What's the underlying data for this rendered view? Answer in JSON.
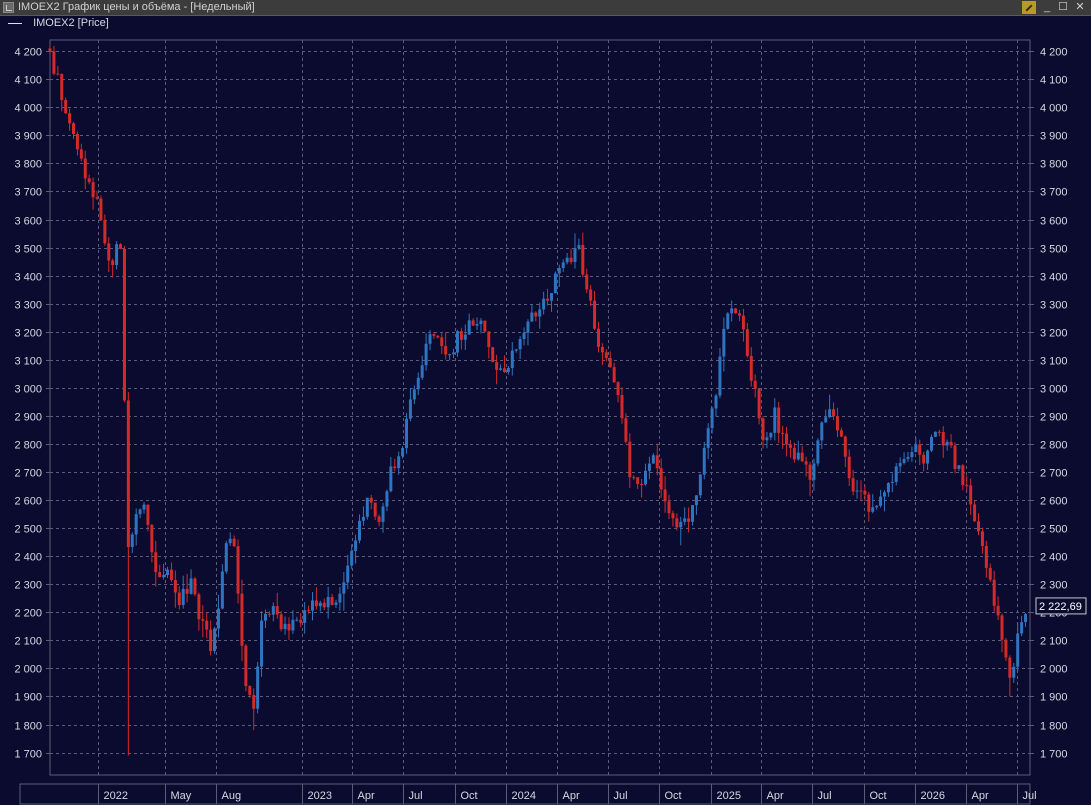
{
  "window": {
    "title": "IMOEX2 График цены и объёма - [Недельный]",
    "minimize_label": "_",
    "maximize_label": "☐",
    "close_label": "✕"
  },
  "legend": {
    "label": "IMOEX2 [Price]"
  },
  "colors": {
    "background": "#0a0b2e",
    "grid": "#5a5c78",
    "up": "#2f74c0",
    "down": "#d42a2a",
    "axis_text": "#d8d8e0"
  },
  "chart_data": {
    "type": "candlestick",
    "series_name": "IMOEX2 [Price]",
    "timeframe": "weekly",
    "ylim": [
      1620,
      4240
    ],
    "y_ticks": [
      "4 200",
      "4 100",
      "4 000",
      "3 900",
      "3 800",
      "3 700",
      "3 600",
      "3 500",
      "3 400",
      "3 300",
      "3 200",
      "3 100",
      "3 000",
      "2 900",
      "2 800",
      "2 700",
      "2 600",
      "2 500",
      "2 400",
      "2 300",
      "2 200",
      "2 100",
      "2 000",
      "1 900",
      "1 800",
      "1 700"
    ],
    "y_tick_values": [
      4200,
      4100,
      4000,
      3900,
      3800,
      3700,
      3600,
      3500,
      3400,
      3300,
      3200,
      3100,
      3000,
      2900,
      2800,
      2700,
      2600,
      2500,
      2400,
      2300,
      2200,
      2100,
      2000,
      1900,
      1800,
      1700
    ],
    "x_ticks": [
      {
        "label": "2022",
        "date": "2022-01-01"
      },
      {
        "label": "May",
        "date": "2022-05-01"
      },
      {
        "label": "Aug",
        "date": "2022-08-01"
      },
      {
        "label": "2023",
        "date": "2023-01-01"
      },
      {
        "label": "Apr",
        "date": "2023-04-01"
      },
      {
        "label": "Jul",
        "date": "2023-07-01"
      },
      {
        "label": "Oct",
        "date": "2023-10-01"
      },
      {
        "label": "2024",
        "date": "2024-01-01"
      },
      {
        "label": "Apr",
        "date": "2024-04-01"
      },
      {
        "label": "Jul",
        "date": "2024-07-01"
      },
      {
        "label": "Oct",
        "date": "2024-10-01"
      },
      {
        "label": "2025",
        "date": "2025-01-01"
      },
      {
        "label": "Apr",
        "date": "2025-04-01"
      },
      {
        "label": "Jul",
        "date": "2025-07-01"
      },
      {
        "label": "Oct",
        "date": "2025-10-01"
      },
      {
        "label": "2026",
        "date": "2026-01-01"
      },
      {
        "label": "Apr",
        "date": "2026-04-01"
      },
      {
        "label": "Jul",
        "date": "2026-07-01"
      }
    ],
    "x_range": [
      "2021-10-08",
      "2026-07-25"
    ],
    "last_price_label": "2 222,69",
    "last_price": 2222.69,
    "close_path": [
      [
        "2021-10-08",
        4200
      ],
      [
        "2021-10-29",
        4050
      ],
      [
        "2021-11-19",
        3900
      ],
      [
        "2021-12-03",
        3800
      ],
      [
        "2021-12-17",
        3750
      ],
      [
        "2022-01-07",
        3620
      ],
      [
        "2022-01-21",
        3450
      ],
      [
        "2022-02-11",
        3500
      ],
      [
        "2022-02-25",
        2450
      ],
      [
        "2022-03-25",
        2600
      ],
      [
        "2022-04-08",
        2400
      ],
      [
        "2022-04-22",
        2300
      ],
      [
        "2022-05-06",
        2350
      ],
      [
        "2022-05-27",
        2250
      ],
      [
        "2022-06-17",
        2300
      ],
      [
        "2022-07-08",
        2150
      ],
      [
        "2022-07-22",
        2080
      ],
      [
        "2022-08-05",
        2200
      ],
      [
        "2022-08-19",
        2450
      ],
      [
        "2022-09-02",
        2420
      ],
      [
        "2022-09-23",
        1950
      ],
      [
        "2022-10-07",
        1850
      ],
      [
        "2022-10-21",
        2150
      ],
      [
        "2022-11-11",
        2200
      ],
      [
        "2022-12-02",
        2150
      ],
      [
        "2022-12-23",
        2160
      ],
      [
        "2023-01-13",
        2200
      ],
      [
        "2023-02-03",
        2250
      ],
      [
        "2023-02-24",
        2220
      ],
      [
        "2023-03-17",
        2300
      ],
      [
        "2023-04-07",
        2450
      ],
      [
        "2023-04-28",
        2600
      ],
      [
        "2023-05-19",
        2550
      ],
      [
        "2023-06-09",
        2700
      ],
      [
        "2023-06-30",
        2800
      ],
      [
        "2023-07-21",
        3000
      ],
      [
        "2023-08-11",
        3150
      ],
      [
        "2023-09-01",
        3200
      ],
      [
        "2023-09-22",
        3120
      ],
      [
        "2023-10-13",
        3200
      ],
      [
        "2023-11-03",
        3250
      ],
      [
        "2023-11-24",
        3200
      ],
      [
        "2023-12-15",
        3050
      ],
      [
        "2024-01-05",
        3100
      ],
      [
        "2024-01-26",
        3150
      ],
      [
        "2024-02-16",
        3250
      ],
      [
        "2024-03-08",
        3300
      ],
      [
        "2024-03-29",
        3380
      ],
      [
        "2024-04-19",
        3450
      ],
      [
        "2024-05-10",
        3480
      ],
      [
        "2024-05-24",
        3380
      ],
      [
        "2024-06-07",
        3200
      ],
      [
        "2024-06-28",
        3100
      ],
      [
        "2024-07-19",
        2950
      ],
      [
        "2024-08-09",
        2700
      ],
      [
        "2024-08-30",
        2650
      ],
      [
        "2024-09-20",
        2750
      ],
      [
        "2024-10-11",
        2600
      ],
      [
        "2024-11-01",
        2520
      ],
      [
        "2024-11-22",
        2500
      ],
      [
        "2024-12-13",
        2700
      ],
      [
        "2025-01-03",
        2900
      ],
      [
        "2025-01-24",
        3200
      ],
      [
        "2025-02-07",
        3280
      ],
      [
        "2025-02-21",
        3250
      ],
      [
        "2025-03-14",
        3050
      ],
      [
        "2025-04-04",
        2800
      ],
      [
        "2025-04-25",
        2900
      ],
      [
        "2025-05-16",
        2800
      ],
      [
        "2025-06-06",
        2750
      ],
      [
        "2025-06-27",
        2700
      ],
      [
        "2025-07-18",
        2850
      ],
      [
        "2025-08-01",
        2950
      ],
      [
        "2025-08-22",
        2800
      ],
      [
        "2025-09-12",
        2650
      ],
      [
        "2025-10-03",
        2600
      ],
      [
        "2025-10-24",
        2550
      ],
      [
        "2025-11-14",
        2650
      ],
      [
        "2025-12-05",
        2750
      ],
      [
        "2025-12-26",
        2780
      ],
      [
        "2026-01-16",
        2750
      ],
      [
        "2026-02-06",
        2850
      ],
      [
        "2026-02-27",
        2800
      ],
      [
        "2026-03-20",
        2700
      ],
      [
        "2026-04-10",
        2600
      ],
      [
        "2026-05-01",
        2450
      ],
      [
        "2026-05-22",
        2250
      ],
      [
        "2026-06-05",
        2100
      ],
      [
        "2026-06-19",
        1950
      ],
      [
        "2026-07-03",
        2120
      ],
      [
        "2026-07-17",
        2222.69
      ]
    ],
    "extremes": [
      {
        "date": "2022-02-25",
        "low": 1690
      },
      {
        "date": "2022-10-07",
        "low": 1780
      },
      {
        "date": "2026-06-19",
        "low": 1900
      }
    ]
  }
}
